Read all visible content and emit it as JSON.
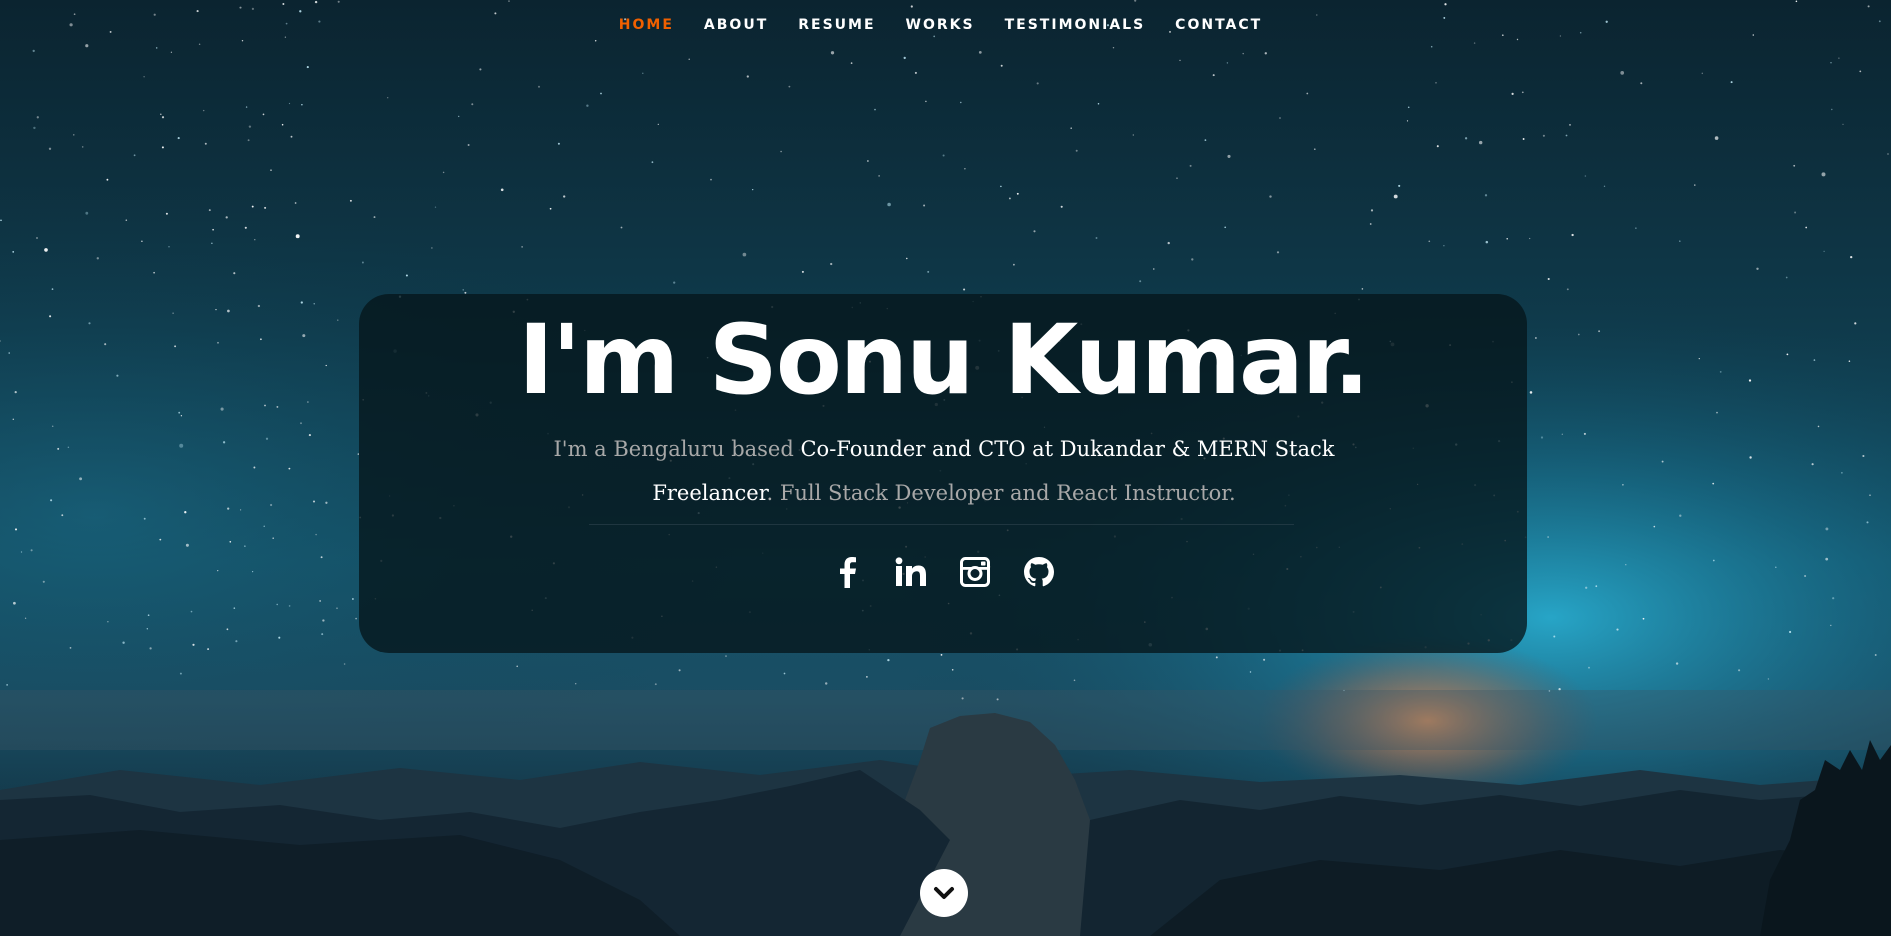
{
  "nav": {
    "items": [
      {
        "label": "HOME",
        "active": true
      },
      {
        "label": "ABOUT",
        "active": false
      },
      {
        "label": "RESUME",
        "active": false
      },
      {
        "label": "WORKS",
        "active": false
      },
      {
        "label": "TESTIMONIALS",
        "active": false
      },
      {
        "label": "CONTACT",
        "active": false
      }
    ],
    "active_color": "#f06000"
  },
  "hero": {
    "title": "I'm Sonu Kumar.",
    "lead_intro": "I'm a Bengaluru based ",
    "lead_role": "Co-Founder and CTO at Dukandar & MERN Stack Freelancer",
    "lead_rest": ". Full Stack Developer and React Instructor."
  },
  "social": [
    {
      "icon": "facebook-icon"
    },
    {
      "icon": "linkedin-icon"
    },
    {
      "icon": "instagram-icon"
    },
    {
      "icon": "github-icon"
    }
  ],
  "scroll": {
    "icon": "chevron-down-icon"
  }
}
